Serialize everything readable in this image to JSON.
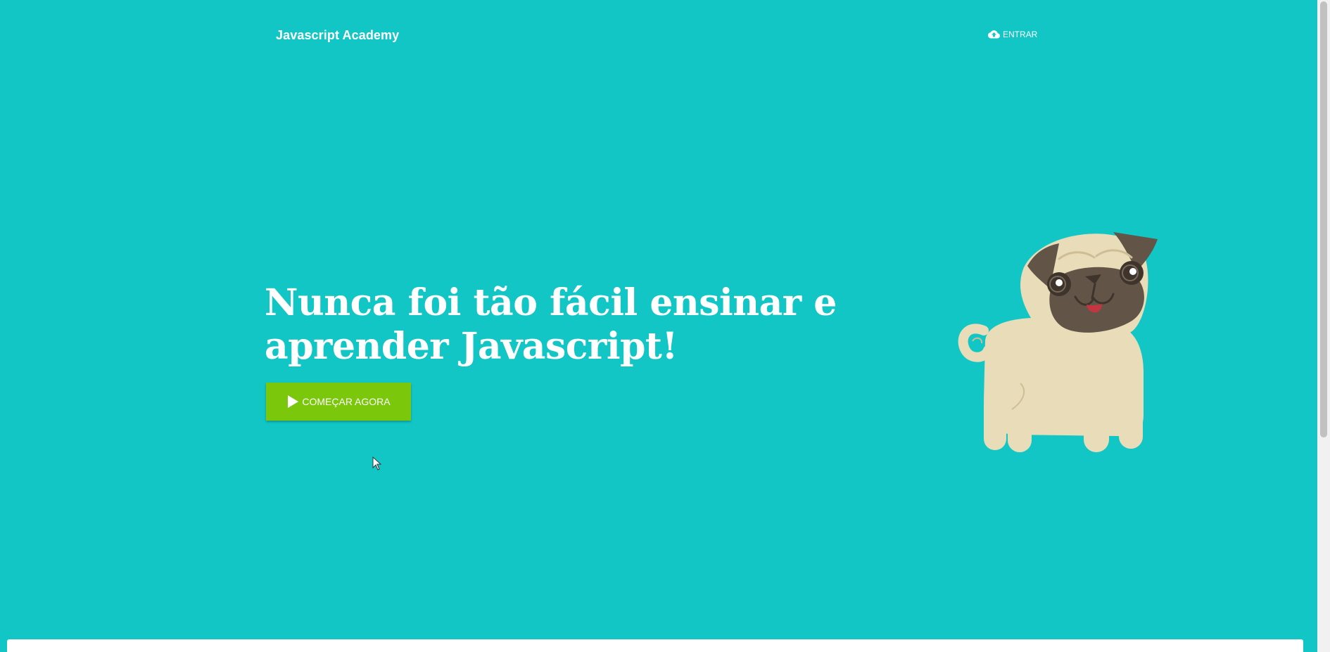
{
  "navbar": {
    "brand": "Javascript Academy",
    "login_label": "ENTRAR",
    "login_icon": "cloud-upload-icon"
  },
  "hero": {
    "title": "Nunca foi tão fácil ensinar e aprender Javascript!",
    "cta_label": "COMEÇAR AGORA",
    "cta_icon": "play-icon",
    "illustration": "pug-illustration"
  },
  "colors": {
    "background": "#13C6C6",
    "cta": "#7AC70C",
    "text": "#FFFFFF"
  }
}
